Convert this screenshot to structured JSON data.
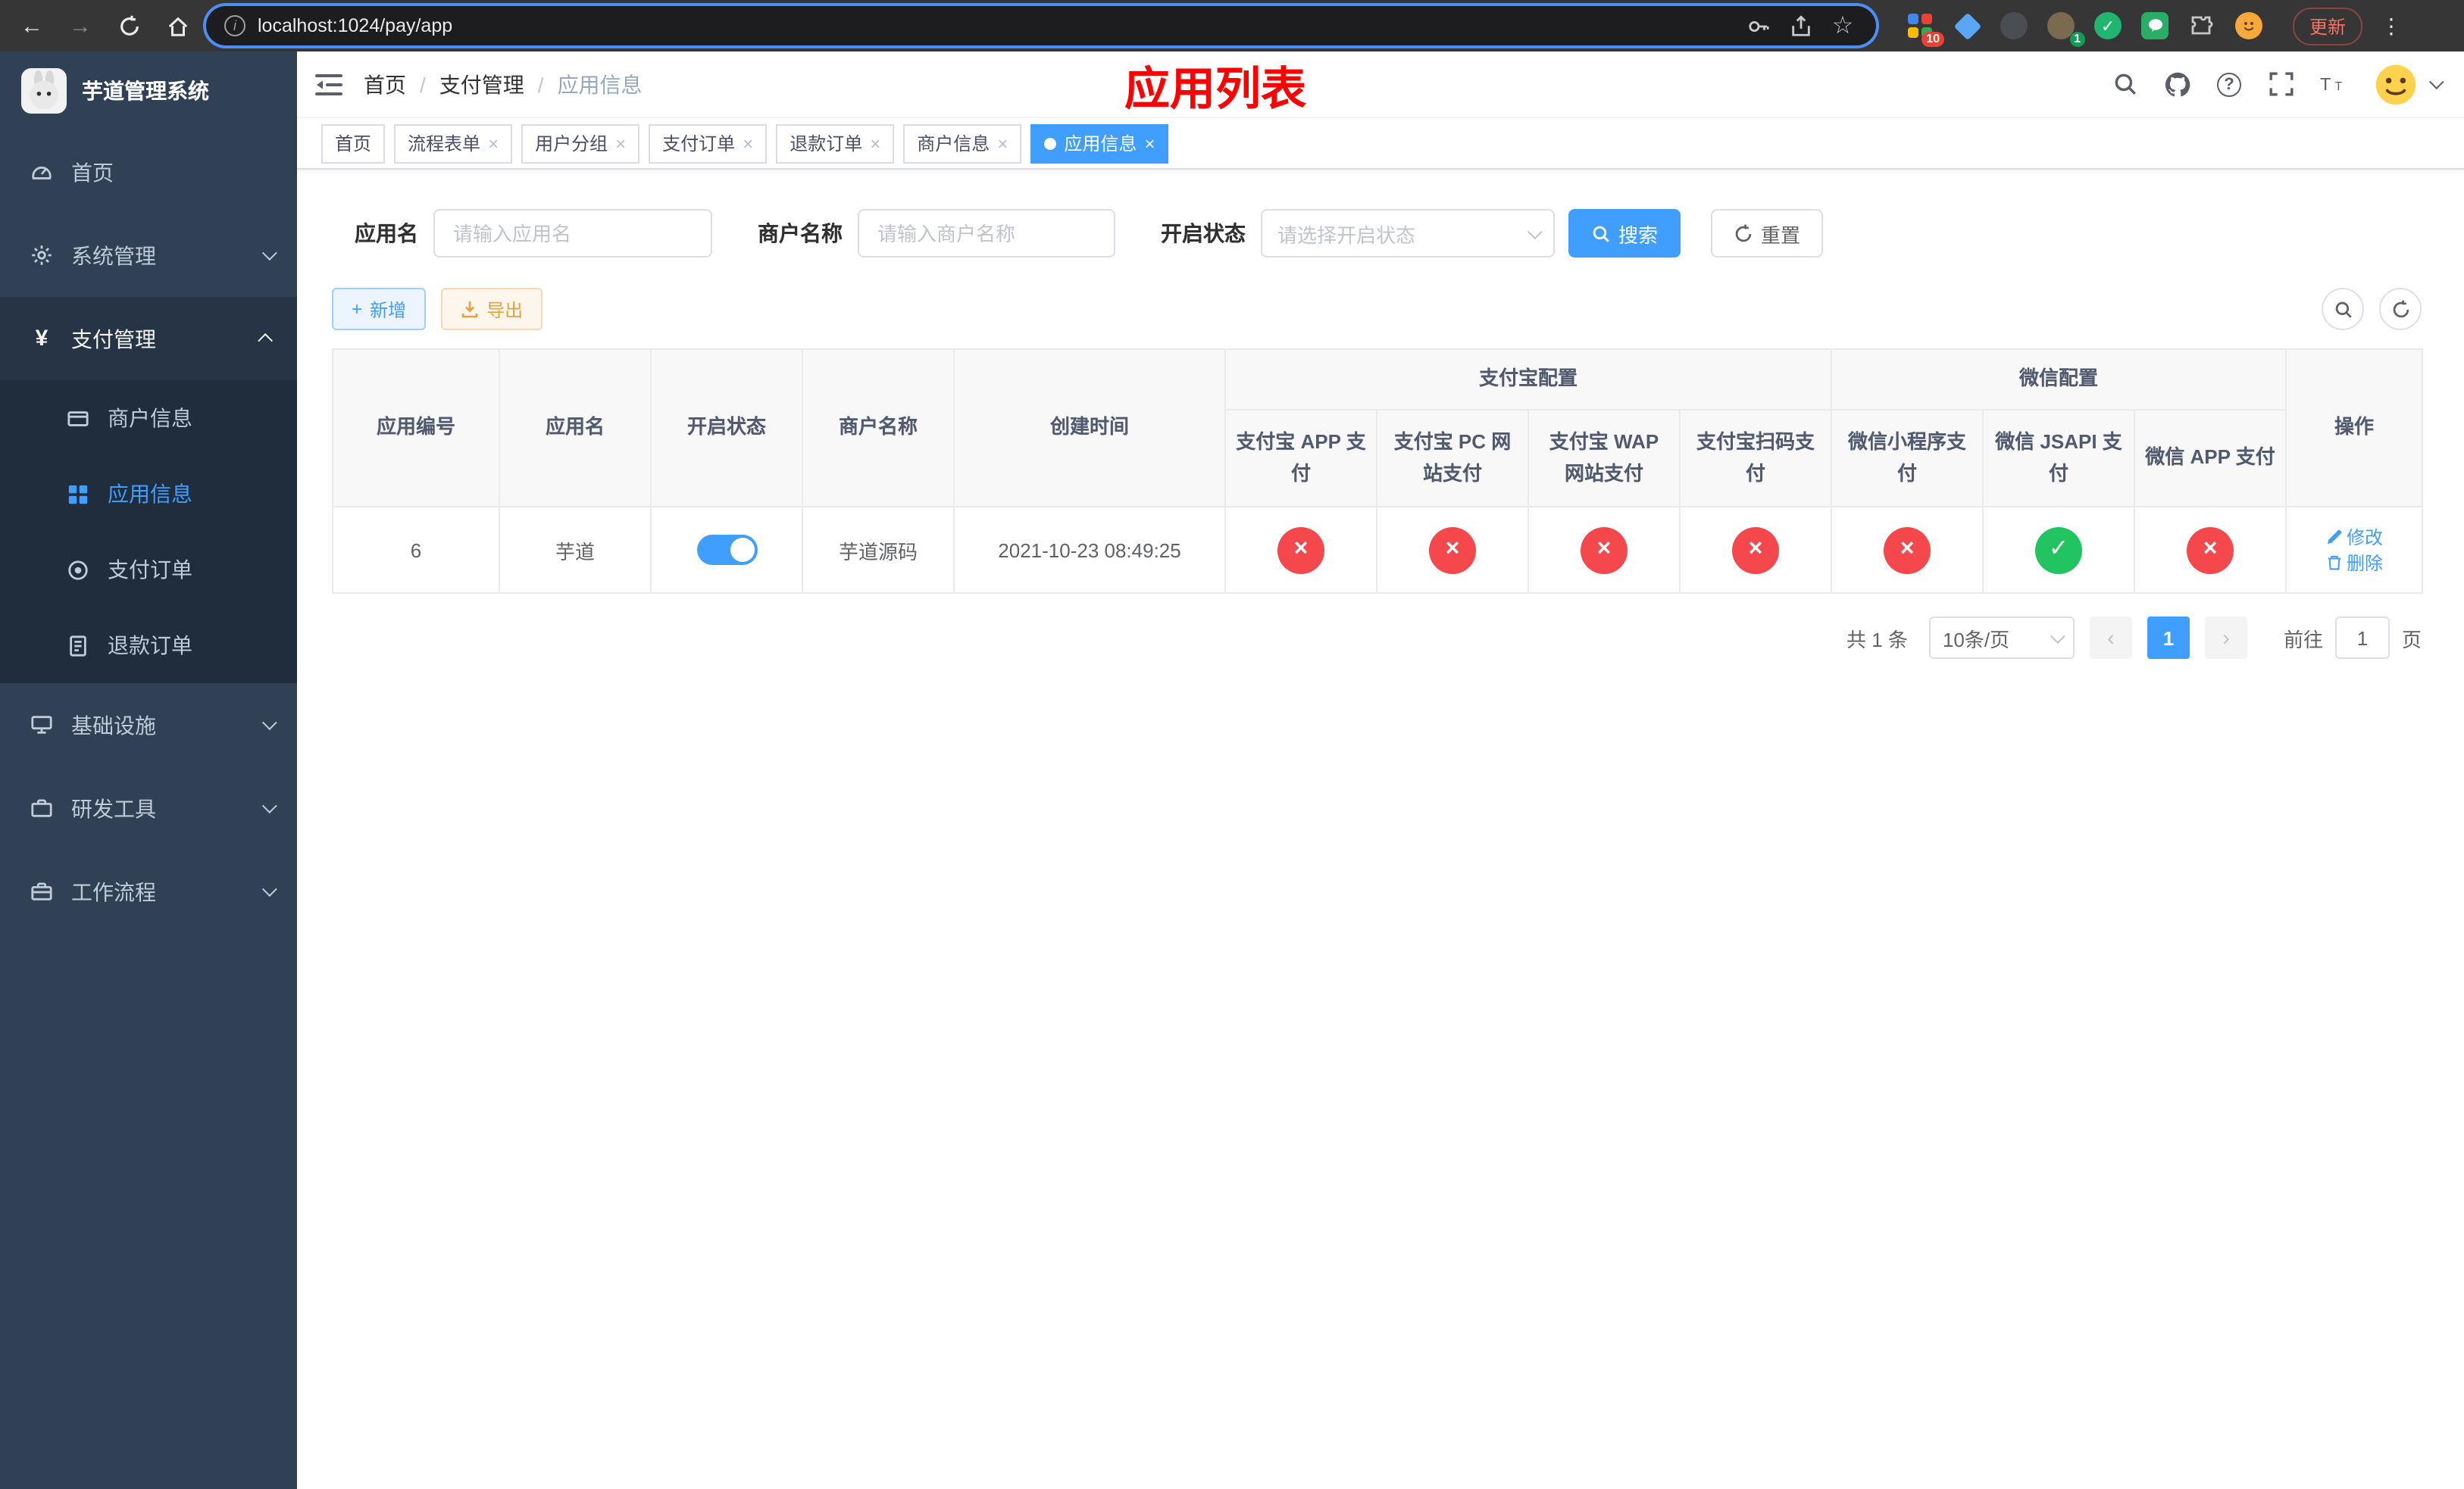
{
  "browser": {
    "url": "localhost:1024/pay/app",
    "update_button": "更新",
    "extension_badges": {
      "grid": "10",
      "avatar": "1"
    }
  },
  "glyphs": {
    "back": "←",
    "forward": "→",
    "star": "☆",
    "kebab": "⋮",
    "info": "i",
    "question": "?",
    "yen": "¥",
    "plus": "+",
    "close": "×",
    "check": "✓",
    "prev": "‹",
    "next": "›"
  },
  "sidebar": {
    "title": "芋道管理系统",
    "home": "首页",
    "system": "系统管理",
    "payment": "支付管理",
    "merchant_info": "商户信息",
    "app_info": "应用信息",
    "pay_order": "支付订单",
    "refund_order": "退款订单",
    "infra": "基础设施",
    "dev_tools": "研发工具",
    "workflow": "工作流程"
  },
  "header": {
    "breadcrumb": {
      "home": "首页",
      "payment": "支付管理",
      "current": "应用信息"
    },
    "title": "应用列表"
  },
  "tabs": {
    "items": [
      "首页",
      "流程表单",
      "用户分组",
      "支付订单",
      "退款订单",
      "商户信息",
      "应用信息"
    ],
    "active": "应用信息"
  },
  "filters": {
    "app_name": {
      "label": "应用名",
      "placeholder": "请输入应用名"
    },
    "merchant": {
      "label": "商户名称",
      "placeholder": "请输入商户名称"
    },
    "status": {
      "label": "开启状态",
      "placeholder": "请选择开启状态"
    },
    "search": "搜索",
    "reset": "重置"
  },
  "toolbar": {
    "add": "新增",
    "export": "导出"
  },
  "table": {
    "groups": {
      "alipay": "支付宝配置",
      "wechat": "微信配置"
    },
    "columns": [
      "应用编号",
      "应用名",
      "开启状态",
      "商户名称",
      "创建时间",
      "支付宝 APP 支付",
      "支付宝 PC 网站支付",
      "支付宝 WAP 网站支付",
      "支付宝扫码支付",
      "微信小程序支付",
      "微信 JSAPI 支付",
      "微信 APP 支付",
      "操作"
    ],
    "rows": [
      {
        "id": "6",
        "name": "芋道",
        "enabled": true,
        "merchant": "芋道源码",
        "created_at": "2021-10-23 08:49:25",
        "channels": [
          "closed",
          "closed",
          "closed",
          "closed",
          "closed",
          "open",
          "closed"
        ],
        "edit": "修改",
        "delete": "删除"
      }
    ]
  },
  "pagination": {
    "total": "共 1 条",
    "page_size": "10条/页",
    "page": "1",
    "goto": "前往",
    "goto_value": "1",
    "unit": "页"
  },
  "colors": {
    "accent": "#409eff",
    "success": "#22c462",
    "danger": "#f5484d",
    "warning": "#e6a23c",
    "title_red": "#ff0000",
    "sidebar_bg": "#304156",
    "submenu_bg": "#1f2d3d"
  }
}
